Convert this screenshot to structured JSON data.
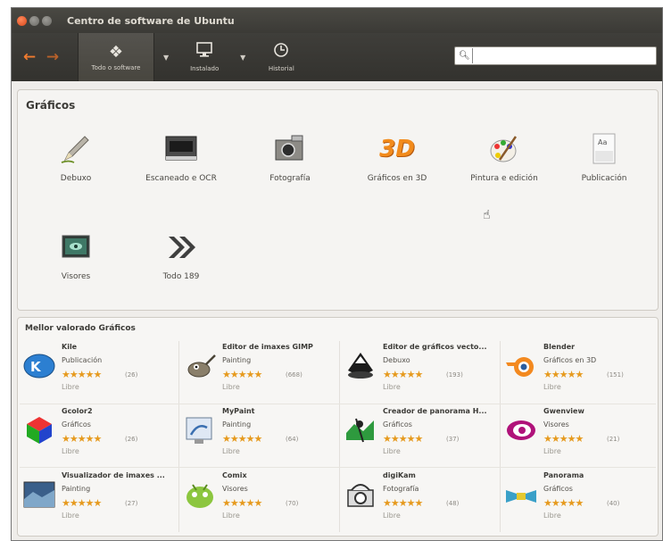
{
  "window": {
    "title": "Centro de software de Ubuntu"
  },
  "toolbar": {
    "back_icon": "back-arrow-icon",
    "forward_icon": "forward-arrow-icon",
    "all_software": "Todo o software",
    "installed": "Instalado",
    "history": "Historial",
    "search_value": "",
    "search_placeholder": ""
  },
  "categories": {
    "title": "Gráficos",
    "items": [
      {
        "label": "Debuxo",
        "icon": "pencil-icon"
      },
      {
        "label": "Escaneado e OCR",
        "icon": "scanner-icon"
      },
      {
        "label": "Fotografía",
        "icon": "camera-icon"
      },
      {
        "label": "Gráficos en 3D",
        "icon": "3d-icon"
      },
      {
        "label": "Pintura e edición",
        "icon": "palette-icon"
      },
      {
        "label": "Publicación",
        "icon": "document-icon"
      },
      {
        "label": "Visores",
        "icon": "viewer-icon"
      },
      {
        "label": "Todo 189",
        "icon": "chevrons-icon"
      }
    ]
  },
  "top_rated": {
    "title": "Mellor valorado Gráficos",
    "apps": [
      {
        "name": "Kile",
        "category": "Publicación",
        "count": "(26)",
        "price": "Libre"
      },
      {
        "name": "Editor de imaxes GIMP",
        "category": "Painting",
        "count": "(668)",
        "price": "Libre"
      },
      {
        "name": "Editor de gráficos vecto...",
        "category": "Debuxo",
        "count": "(193)",
        "price": "Libre"
      },
      {
        "name": "Blender",
        "category": "Gráficos en 3D",
        "count": "(151)",
        "price": "Libre"
      },
      {
        "name": "Gcolor2",
        "category": "Gráficos",
        "count": "(26)",
        "price": "Libre"
      },
      {
        "name": "MyPaint",
        "category": "Painting",
        "count": "(64)",
        "price": "Libre"
      },
      {
        "name": "Creador de panorama H...",
        "category": "Gráficos",
        "count": "(37)",
        "price": "Libre"
      },
      {
        "name": "Gwenview",
        "category": "Visores",
        "count": "(21)",
        "price": "Libre"
      },
      {
        "name": "Visualizador de imaxes ...",
        "category": "Painting",
        "count": "(27)",
        "price": "Libre"
      },
      {
        "name": "Comix",
        "category": "Visores",
        "count": "(70)",
        "price": "Libre"
      },
      {
        "name": "digiKam",
        "category": "Fotografía",
        "count": "(48)",
        "price": "Libre"
      },
      {
        "name": "Panorama",
        "category": "Gráficos",
        "count": "(40)",
        "price": "Libre"
      }
    ],
    "stars": "★★★★★"
  },
  "colors": {
    "accent": "#f07b2f",
    "titlebar": "#3b3a36",
    "stars": "#e69a1e"
  }
}
